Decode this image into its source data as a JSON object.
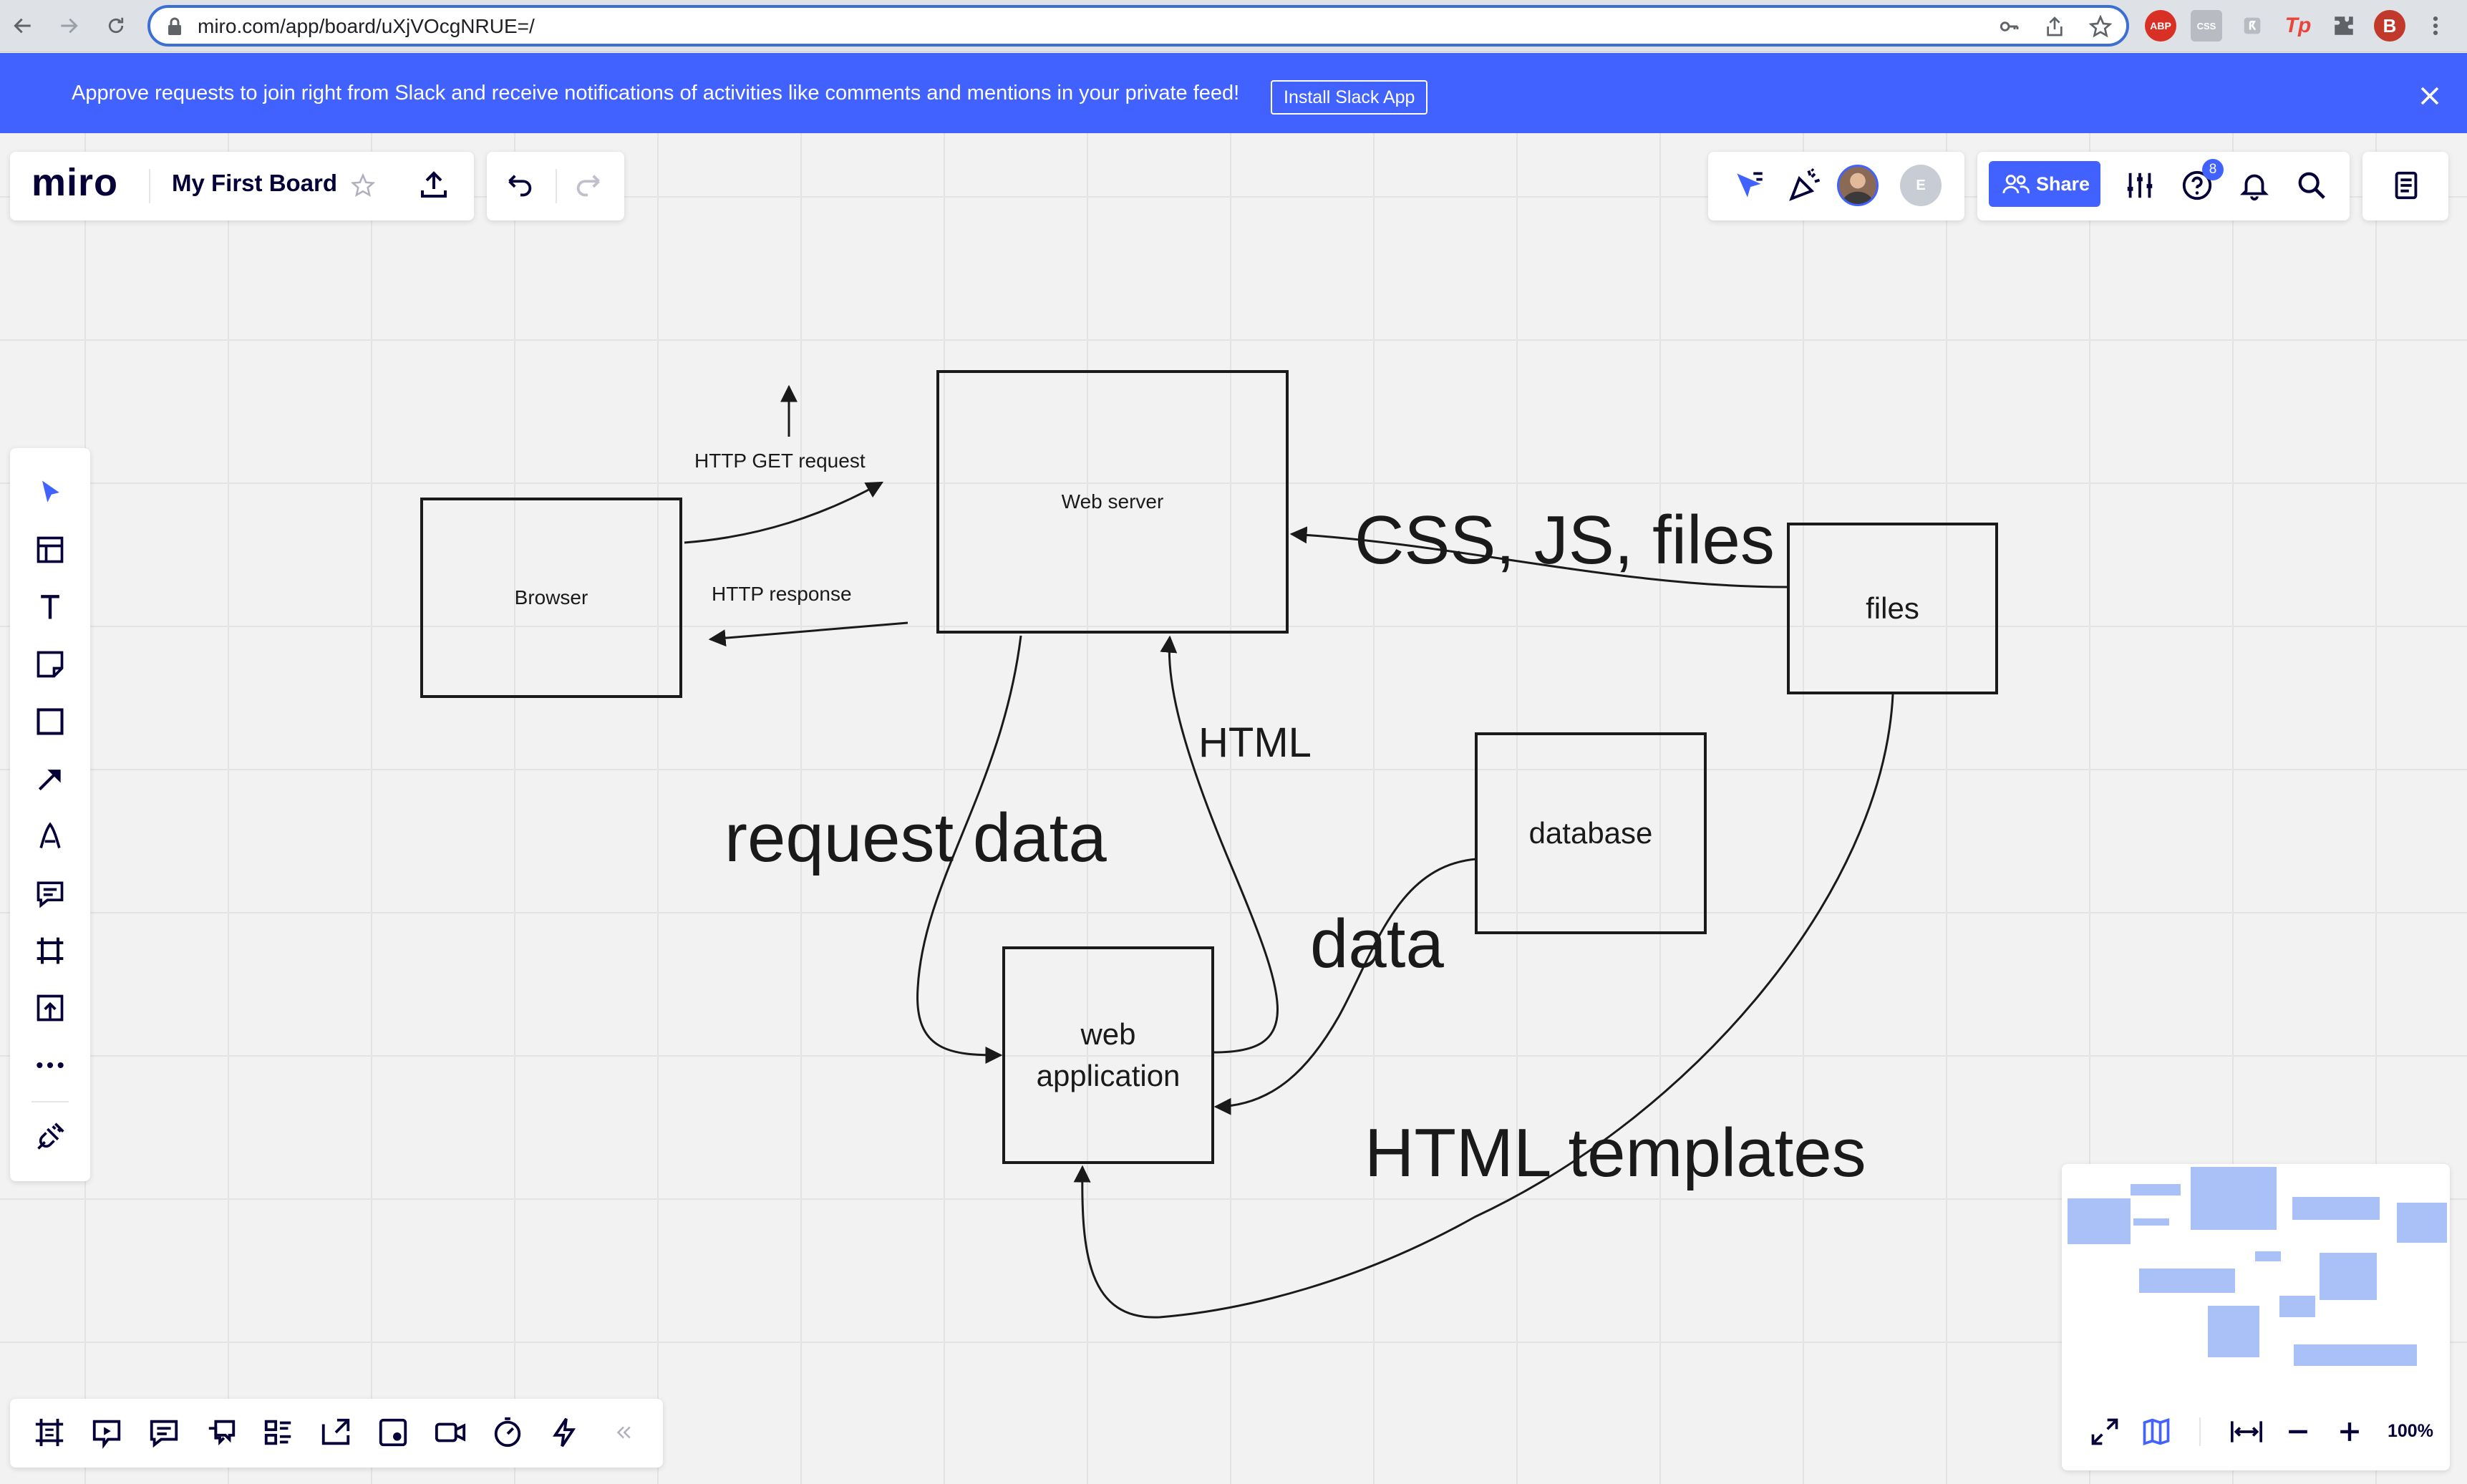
{
  "browser": {
    "url": "miro.com/app/board/uXjVOcgNRUE=/",
    "extensions": [
      "ABP",
      "CSS",
      "Tp"
    ],
    "profile_initial": "B"
  },
  "banner": {
    "text": "Approve requests to join right from Slack and receive notifications of activities like comments and mentions in your private feed!",
    "button_label": "Install Slack App"
  },
  "header": {
    "logo": "miro",
    "board_title": "My First Board",
    "share_label": "Share",
    "help_badge_count": "8",
    "collaborator_initial": "E"
  },
  "left_toolbar": {
    "tools": [
      "select-tool",
      "templates-tool",
      "text-tool",
      "sticky-note-tool",
      "shape-tool",
      "connection-line-tool",
      "pen-tool",
      "comment-tool",
      "frame-tool",
      "upload-tool",
      "more-tools",
      "apps-tool"
    ]
  },
  "bottom_toolbar": {
    "tools": [
      "frames",
      "presentation",
      "comments",
      "chat",
      "cards",
      "share-screen",
      "video-embed",
      "video-call",
      "timer",
      "lightning"
    ]
  },
  "zoom": {
    "level": "100%"
  },
  "diagram": {
    "boxes": {
      "browser": "Browser",
      "web_server": "Web server",
      "files": "files",
      "database": "database",
      "web_application": "web application"
    },
    "labels": {
      "http_get": "HTTP GET request",
      "http_response": "HTTP response",
      "css_js_files": "CSS, JS, files",
      "html": "HTML",
      "request_data": "request data",
      "data": "data",
      "html_templates": "HTML templates"
    }
  },
  "colors": {
    "accent": "#4262ff",
    "banner": "#4262ff",
    "canvas": "#f2f2f2",
    "minimap_block": "#a9c1f7"
  }
}
